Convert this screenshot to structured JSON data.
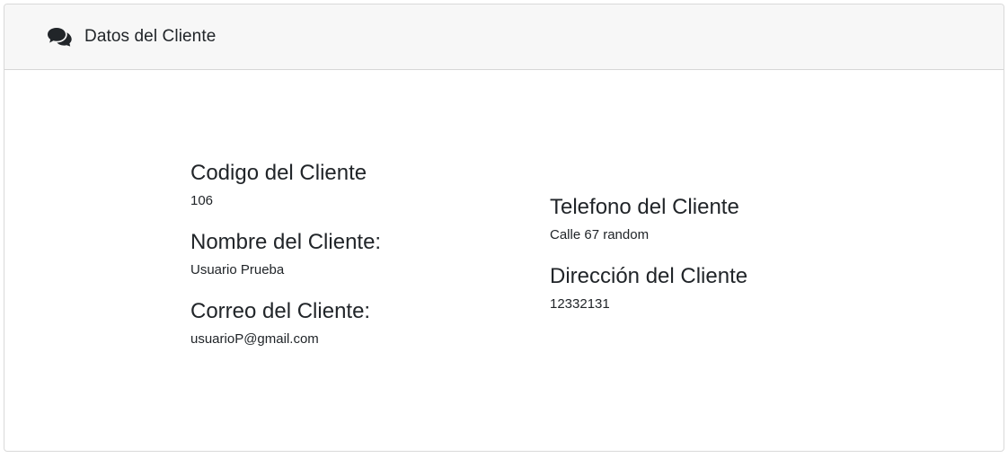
{
  "header": {
    "title": "Datos del Cliente",
    "icon": "comments-icon"
  },
  "left_fields": [
    {
      "label": "Codigo del Cliente",
      "value": "106"
    },
    {
      "label": "Nombre del Cliente:",
      "value": "Usuario Prueba"
    },
    {
      "label": "Correo del Cliente:",
      "value": "usuarioP@gmail.com"
    }
  ],
  "right_fields": [
    {
      "label": "Telefono del Cliente",
      "value": "Calle 67 random"
    },
    {
      "label": "Dirección del Cliente",
      "value": "12332131"
    }
  ],
  "colors": {
    "header_bg": "#f7f7f7",
    "border": "#d9d9d9",
    "text": "#212529"
  }
}
